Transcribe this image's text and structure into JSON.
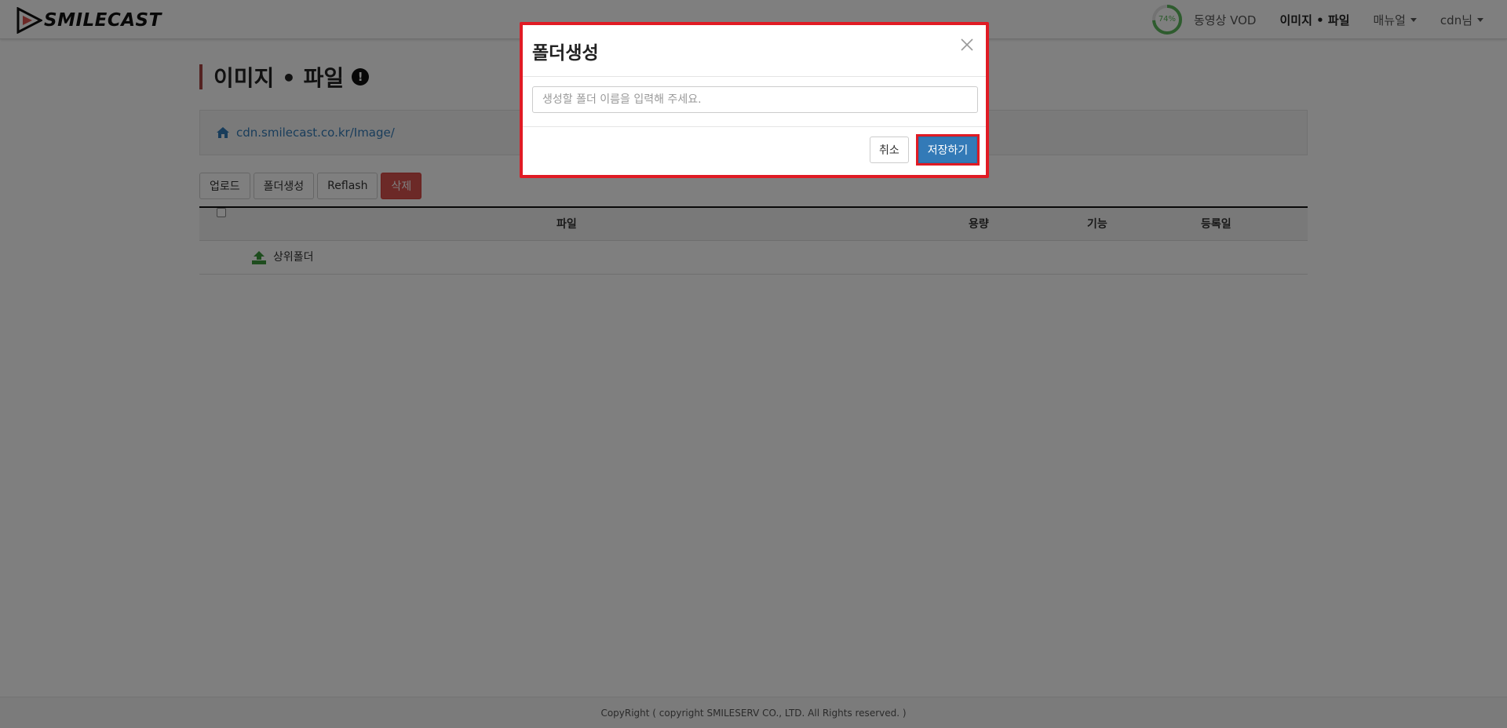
{
  "header": {
    "brand": "SMILECAST",
    "usage_label": "74%",
    "usage_percent": 74,
    "nav": [
      {
        "label": "동영상 VOD"
      },
      {
        "label": "이미지 • 파일"
      },
      {
        "label": "매뉴얼"
      },
      {
        "label": "cdn님"
      }
    ]
  },
  "page": {
    "title": "이미지 • 파일",
    "info_glyph": "!",
    "path": "cdn.smilecast.co.kr/Image/"
  },
  "toolbar": {
    "upload": "업로드",
    "new_folder": "폴더생성",
    "refresh": "Reflash",
    "delete": "삭제"
  },
  "table": {
    "columns": [
      "파일",
      "용량",
      "기능",
      "등록일"
    ],
    "rows": [
      {
        "name": "상위폴더"
      }
    ]
  },
  "footer": {
    "copyright": "CopyRight ( copyright SMILESERV CO., LTD. All Rights reserved. )"
  },
  "modal": {
    "title": "폴더생성",
    "input_value": "",
    "input_placeholder": "생성할 폴더 이름을 입력해 주세요.",
    "cancel": "취소",
    "save": "저장하기"
  },
  "colors": {
    "accent": "#337ab7",
    "danger": "#d9534f",
    "highlight": "#e01b24",
    "usage_ring": "#5cb85c"
  },
  "icons": [
    "brand-logo-icon",
    "info-icon",
    "home-icon",
    "upload-folder-icon",
    "close-icon",
    "caret-down-icon"
  ]
}
